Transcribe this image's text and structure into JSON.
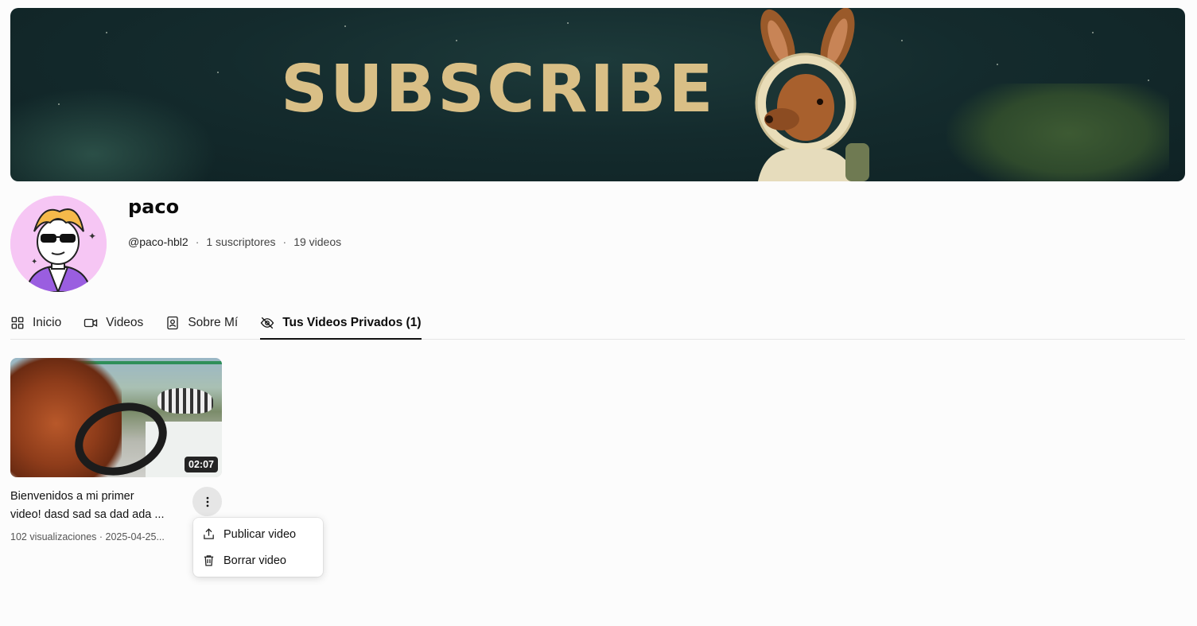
{
  "banner": {
    "text": "SUBSCRIBE"
  },
  "channel": {
    "name": "paco",
    "handle": "@paco-hbl2",
    "subscribers": "1 suscriptores",
    "videos_count": "19 videos",
    "separator": "·"
  },
  "tabs": [
    {
      "label": "Inicio",
      "icon": "grid-icon",
      "active": false
    },
    {
      "label": "Videos",
      "icon": "video-camera-icon",
      "active": false
    },
    {
      "label": "Sobre Mí",
      "icon": "contact-book-icon",
      "active": false
    },
    {
      "label": "Tus Videos Privados (1)",
      "icon": "eye-off-icon",
      "active": true
    }
  ],
  "videos": [
    {
      "title_line1": "Bienvenidos a mi primer",
      "title_line2": "video! dasd sad sa dad ada ...",
      "duration": "02:07",
      "meta": "102 visualizaciones · 2025-04-25..."
    }
  ],
  "menu": {
    "items": [
      {
        "label": "Publicar video",
        "icon": "upload-icon"
      },
      {
        "label": "Borrar video",
        "icon": "trash-icon"
      }
    ]
  },
  "colors": {
    "banner_bg": "#142b2d",
    "banner_text": "#d9bf86",
    "avatar_bg": "#f6c6f4",
    "active_tab_underline": "#111111"
  }
}
